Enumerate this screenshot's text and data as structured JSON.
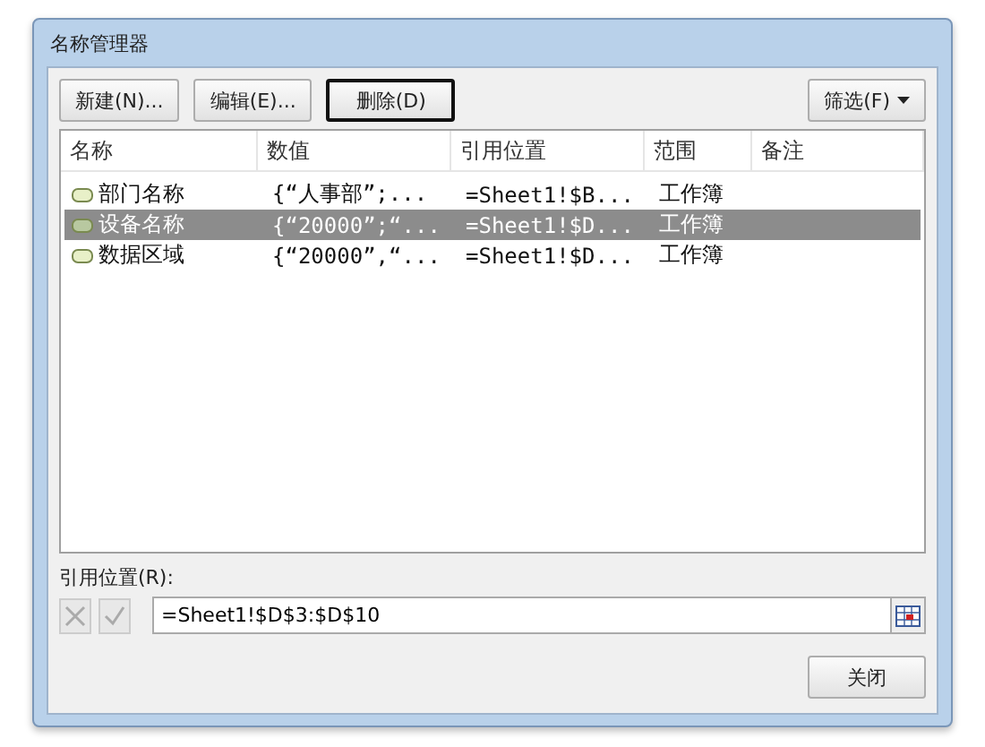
{
  "window": {
    "title": "名称管理器"
  },
  "toolbar": {
    "buttons": [
      {
        "label": "新建(N)...",
        "focused": false
      },
      {
        "label": "编辑(E)...",
        "focused": false
      },
      {
        "label": "删除(D)",
        "focused": true
      }
    ],
    "filter_button": {
      "label": "筛选(F)"
    }
  },
  "table": {
    "columns": [
      "名称",
      "数值",
      "引用位置",
      "范围",
      "备注"
    ],
    "rows": [
      {
        "cells": [
          "部门名称",
          "{“人事部”;...",
          "=Sheet1!$B...",
          "工作簿",
          ""
        ],
        "selected": false
      },
      {
        "cells": [
          "设备名称",
          "{“20000”;“...",
          "=Sheet1!$D...",
          "工作簿",
          ""
        ],
        "selected": true
      },
      {
        "cells": [
          "数据区域",
          "{“20000”,“...",
          "=Sheet1!$D...",
          "工作簿",
          ""
        ],
        "selected": false
      }
    ]
  },
  "reference": {
    "label": "引用位置(R):",
    "value": "=Sheet1!$D$3:$D$10"
  },
  "close_button": {
    "label": "关闭"
  }
}
